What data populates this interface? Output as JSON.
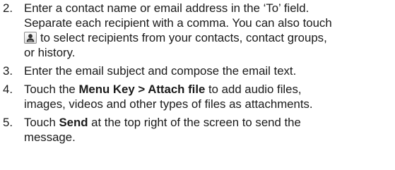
{
  "steps": [
    {
      "number": "2.",
      "lines": [
        "Enter a contact name or email address in the ‘To’ field.",
        "Separate each recipient with a comma. You can also touch"
      ],
      "icon": "contact-icon",
      "icon_line_text": "to select recipients from your contacts, contact groups,",
      "last_line": "or history."
    },
    {
      "number": "3.",
      "text": "Enter the email subject and compose the email text."
    },
    {
      "number": "4.",
      "pre": "Touch the ",
      "bold": "Menu Key > Attach file",
      "post": " to add audio files,",
      "line2": "images, videos and other types of files as attachments."
    },
    {
      "number": "5.",
      "pre": "Touch ",
      "bold": "Send",
      "post": " at the top right of the screen to send the",
      "line2": "message."
    }
  ]
}
